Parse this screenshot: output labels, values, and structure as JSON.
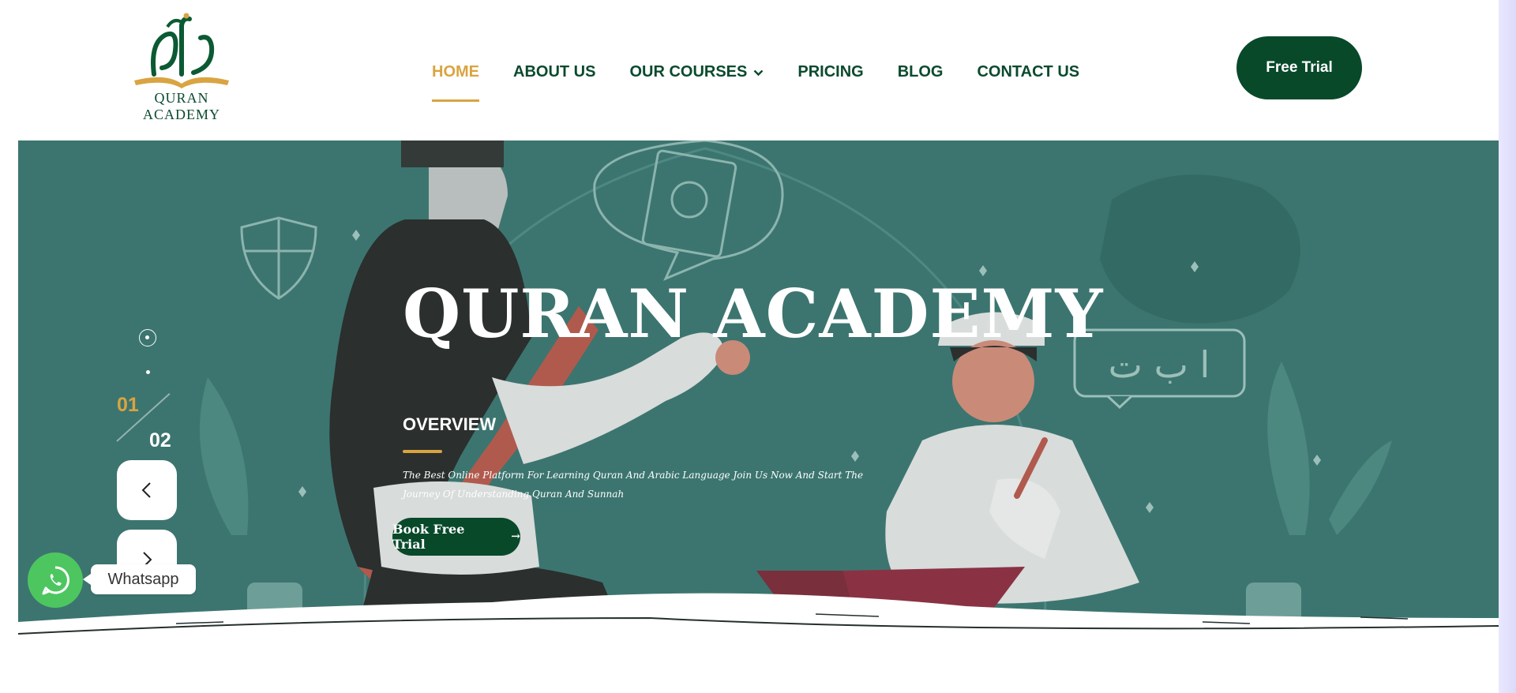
{
  "brand": {
    "logo_text": "QURAN ACADEMY",
    "colors": {
      "primary": "#08492a",
      "accent": "#d9a441",
      "hero_bg": "#3c756f"
    }
  },
  "nav": {
    "items": [
      {
        "label": "HOME",
        "active": true
      },
      {
        "label": "ABOUT US",
        "active": false
      },
      {
        "label": "OUR COURSES",
        "active": false,
        "has_dropdown": true
      },
      {
        "label": "PRICING",
        "active": false
      },
      {
        "label": "BLOG",
        "active": false
      },
      {
        "label": "CONTACT US",
        "active": false
      }
    ],
    "cta": "Free Trial"
  },
  "hero": {
    "title": "QURAN ACADEMY",
    "section_label": "OVERVIEW",
    "description": "The Best Online Platform For Learning Quran And Arabic Language Join Us Now And Start The Journey Of Understanding Quran And Sunnah",
    "button": "Book Free Trial",
    "illustration_letters": "ا ب ت"
  },
  "slider": {
    "current": "01",
    "total": "02",
    "prev_icon": "chevron-left-icon",
    "next_icon": "chevron-right-icon"
  },
  "whatsapp": {
    "label": "Whatsapp",
    "icon": "whatsapp-icon"
  }
}
